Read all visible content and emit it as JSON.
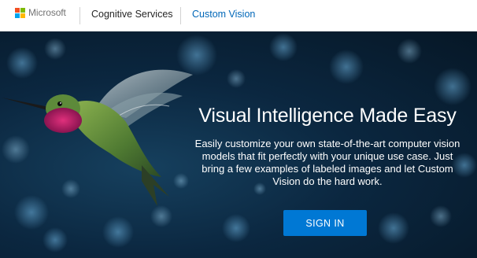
{
  "header": {
    "brand": "Microsoft",
    "nav": [
      {
        "label": "Cognitive Services"
      },
      {
        "label": "Custom Vision"
      }
    ]
  },
  "hero": {
    "title": "Visual Intelligence Made Easy",
    "subtitle": "Easily customize your own state-of-the-art computer vision models that fit perfectly with your unique use case. Just bring a few examples of labeled images and let Custom Vision do the hard work.",
    "cta_label": "SIGN IN",
    "image": "hummingbird-photo"
  },
  "colors": {
    "accent": "#0067b8",
    "button": "#0078d4",
    "hero_bg": "#0b2740"
  }
}
